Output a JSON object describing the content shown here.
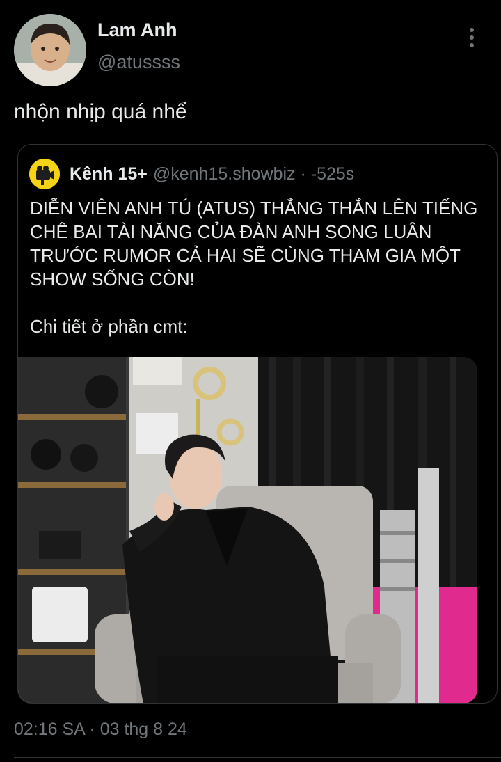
{
  "author": {
    "display_name": "Lam Anh",
    "handle": "@atussss"
  },
  "tweet": {
    "text": "nhộn nhịp quá nhể",
    "timestamp": "02:16 SA · 03 thg 8 24"
  },
  "quoted_tweet": {
    "display_name": "Kênh 15+",
    "meta": "@kenh15.showbiz · -525s",
    "paragraph_1": "DIỄN VIÊN ANH TÚ (ATUS) THẲNG THẮN LÊN TIẾNG CHÊ BAI TÀI NĂNG CỦA ĐÀN ANH SONG LUÂN TRƯỚC RUMOR CẢ HAI SẼ CÙNG THAM GIA MỘT SHOW SỐNG CÒN!",
    "paragraph_2": "Chi tiết ở phần cmt:"
  },
  "icons": {
    "more": "more-vertical-icon"
  },
  "colors": {
    "background": "#000000",
    "text": "#e7e9ea",
    "secondary_text": "#71767b",
    "border": "#2f3336",
    "photo_accent_pink": "#e02a8e"
  }
}
